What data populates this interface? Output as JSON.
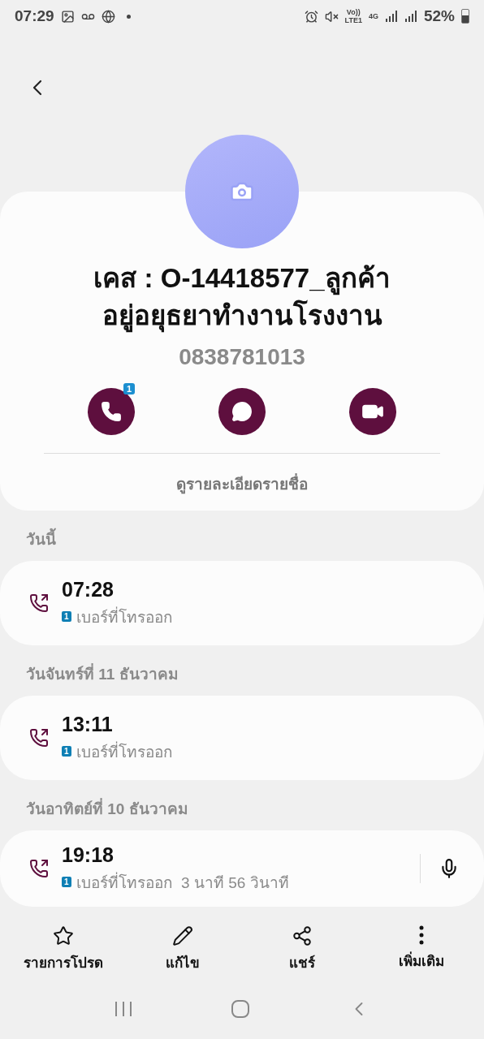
{
  "status_bar": {
    "time": "07:29",
    "network_top": "Vo))",
    "network_bottom": "LTE1",
    "data_type": "4G",
    "battery": "52%"
  },
  "contact": {
    "name": "เคส : O-14418577_ลูกค้าอยู่อยุธยาทำงานโรงงาน",
    "phone": "0838781013",
    "call_badge": "1",
    "details_link": "ดูรายละเอียดรายชื่อ"
  },
  "call_log": [
    {
      "date": "วันนี้",
      "time": "07:28",
      "sim": "1",
      "description": "เบอร์ที่โทรออก",
      "recording": false
    },
    {
      "date": "วันจันทร์ที่ 11 ธันวาคม",
      "time": "13:11",
      "sim": "1",
      "description": "เบอร์ที่โทรออก",
      "recording": false
    },
    {
      "date": "วันอาทิตย์ที่ 10 ธันวาคม",
      "time": "19:18",
      "sim": "1",
      "description": "เบอร์ที่โทรออก  3 นาที 56 วินาที",
      "recording": true
    }
  ],
  "bottom_actions": [
    {
      "kind": "favorite",
      "label": "รายการโปรด"
    },
    {
      "kind": "edit",
      "label": "แก้ไข"
    },
    {
      "kind": "share",
      "label": "แชร์"
    },
    {
      "kind": "more",
      "label": "เพิ่มเติม"
    }
  ]
}
